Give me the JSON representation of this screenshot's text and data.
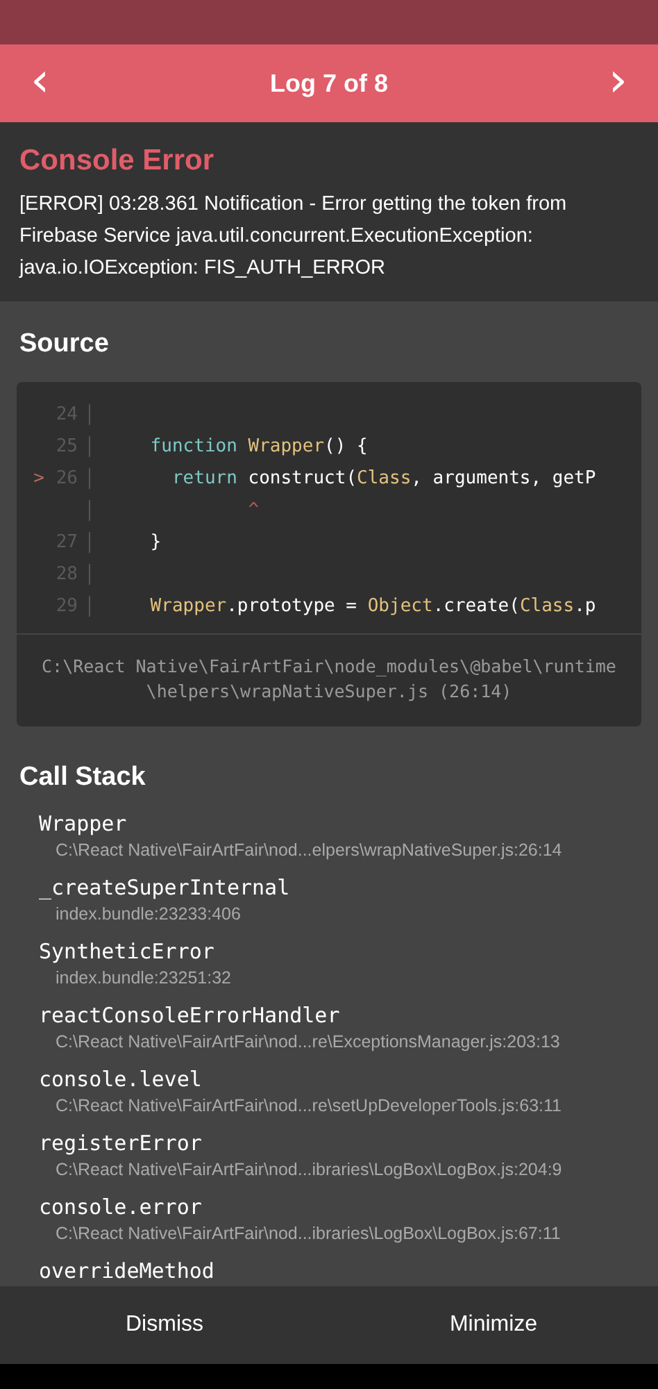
{
  "header": {
    "prev": "‹",
    "title": "Log 7 of 8",
    "next": "›"
  },
  "error": {
    "title": "Console Error",
    "message": "[ERROR] 03:28.361 Notification - Error getting the token from Firebase Service java.util.concurrent.ExecutionException: java.io.IOException: FIS_AUTH_ERROR"
  },
  "source": {
    "title": "Source",
    "lines": [
      {
        "number": "24"
      },
      {
        "number": "25",
        "tokens": [
          {
            "text": "    function ",
            "kind": "keyword"
          },
          {
            "text": "Wrapper",
            "kind": "name"
          },
          {
            "text": "() {",
            "kind": "plain"
          }
        ]
      },
      {
        "number": "26",
        "marker": ">",
        "tokens": [
          {
            "text": "      return",
            "kind": "keyword"
          },
          {
            "text": " construct(",
            "kind": "plain"
          },
          {
            "text": "Class",
            "kind": "name"
          },
          {
            "text": ", arguments, getP",
            "kind": "plain"
          }
        ]
      },
      {
        "tokens": [
          {
            "text": "             ^",
            "kind": "caret"
          }
        ]
      },
      {
        "number": "27",
        "tokens": [
          {
            "text": "    }",
            "kind": "plain"
          }
        ]
      },
      {
        "number": "28"
      },
      {
        "number": "29",
        "tokens": [
          {
            "text": "    Wrapper",
            "kind": "name"
          },
          {
            "text": ".prototype = ",
            "kind": "plain"
          },
          {
            "text": "Object",
            "kind": "name"
          },
          {
            "text": ".create(",
            "kind": "plain"
          },
          {
            "text": "Class",
            "kind": "name"
          },
          {
            "text": ".p",
            "kind": "plain"
          }
        ]
      }
    ],
    "file": "C:\\React Native\\FairArtFair\\node_modules\\@babel\\runtime\\helpers\\wrapNativeSuper.js (26:14)"
  },
  "call_stack": {
    "title": "Call Stack",
    "frames": [
      {
        "name": "Wrapper",
        "location": "C:\\React Native\\FairArtFair\\nod...elpers\\wrapNativeSuper.js:26:14"
      },
      {
        "name": "_createSuperInternal",
        "location": "index.bundle:23233:406"
      },
      {
        "name": "SyntheticError",
        "location": "index.bundle:23251:32"
      },
      {
        "name": "reactConsoleErrorHandler",
        "location": "C:\\React Native\\FairArtFair\\nod...re\\ExceptionsManager.js:203:13"
      },
      {
        "name": "console.level",
        "location": "C:\\React Native\\FairArtFair\\nod...re\\setUpDeveloperTools.js:63:11"
      },
      {
        "name": "registerError",
        "location": "C:\\React Native\\FairArtFair\\nod...ibraries\\LogBox\\LogBox.js:204:9"
      },
      {
        "name": "console.error",
        "location": "C:\\React Native\\FairArtFair\\nod...ibraries\\LogBox\\LogBox.js:67:11"
      },
      {
        "name": "overrideMethod"
      }
    ]
  },
  "footer": {
    "buttons": [
      "Dismiss",
      "Minimize"
    ]
  }
}
